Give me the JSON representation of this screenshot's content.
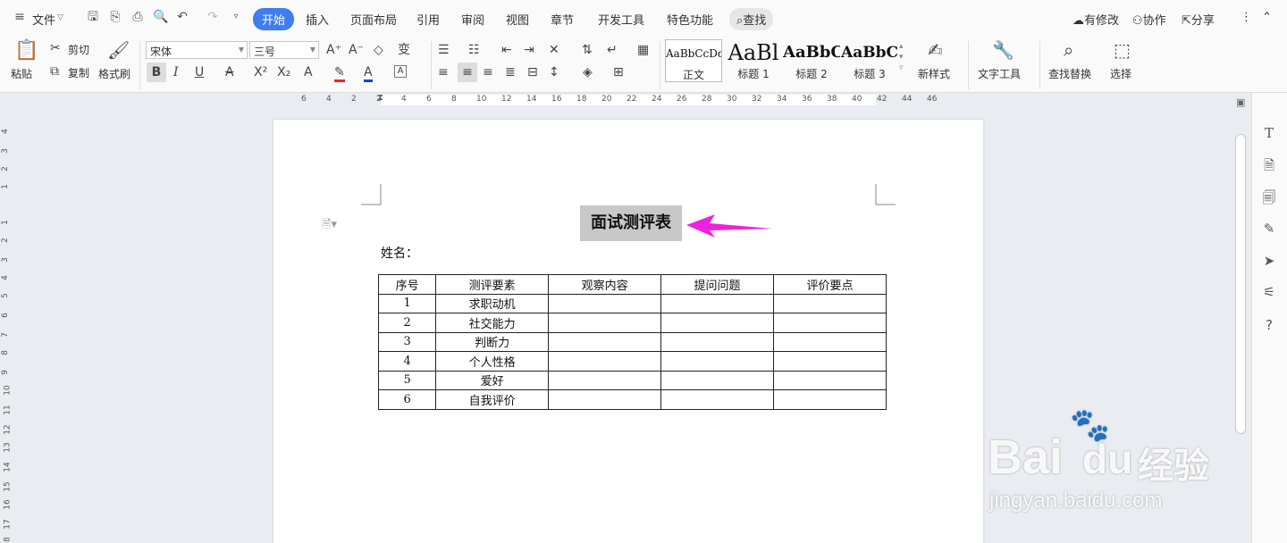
{
  "menubar": {
    "file": "文件",
    "tabs": [
      "开始",
      "插入",
      "页面布局",
      "引用",
      "审阅",
      "视图",
      "章节",
      "开发工具",
      "特色功能"
    ],
    "search": "查找",
    "modified": "有修改",
    "collab": "协作",
    "share": "分享"
  },
  "ribbon": {
    "paste": "粘贴",
    "cut": "剪切",
    "copy": "复制",
    "format_painter": "格式刷",
    "font_name": "宋体",
    "font_size": "三号",
    "styles": [
      {
        "preview": "AaBbCcDd",
        "label": "正文"
      },
      {
        "preview": "AaBl",
        "label": "标题 1"
      },
      {
        "preview": "AaBbC",
        "label": "标题 2"
      },
      {
        "preview": "AaBbC",
        "label": "标题 3"
      }
    ],
    "new_style": "新样式",
    "text_tool": "文字工具",
    "find_replace": "查找替换",
    "select": "选择"
  },
  "ruler": {
    "h": [
      "6",
      "4",
      "2",
      "2",
      "4",
      "6",
      "8",
      "10",
      "12",
      "14",
      "16",
      "18",
      "20",
      "22",
      "24",
      "26",
      "28",
      "30",
      "32",
      "34",
      "36",
      "38",
      "40",
      "42",
      "44",
      "46"
    ],
    "v": [
      "4",
      "3",
      "2",
      "1",
      "1",
      "2",
      "3",
      "4",
      "5",
      "6",
      "7",
      "8",
      "9",
      "10",
      "11",
      "12",
      "13",
      "14",
      "15",
      "16",
      "17",
      "18"
    ]
  },
  "document": {
    "title": "面试测评表",
    "name_label": "姓名：",
    "table_headers": [
      "序号",
      "测评要素",
      "观察内容",
      "提问问题",
      "评价要点"
    ],
    "table_rows": [
      [
        "1",
        "求职动机",
        "",
        "",
        ""
      ],
      [
        "2",
        "社交能力",
        "",
        "",
        ""
      ],
      [
        "3",
        "判断力",
        "",
        "",
        ""
      ],
      [
        "4",
        "个人性格",
        "",
        "",
        ""
      ],
      [
        "5",
        "爱好",
        "",
        "",
        ""
      ],
      [
        "6",
        "自我评价",
        "",
        "",
        ""
      ]
    ]
  },
  "watermark": {
    "brand": "Bai",
    "brand2": "du",
    "cn": "经验",
    "url": "jingyan.baidu.com"
  },
  "colors": {
    "accent": "#3f7ef0",
    "arrow": "#ee22dd",
    "highlight": "#c8c8c8"
  }
}
